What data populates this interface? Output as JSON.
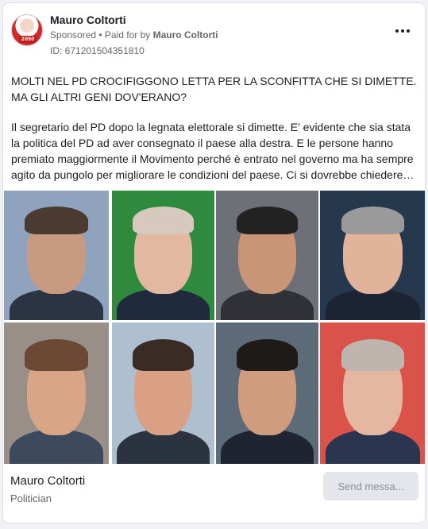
{
  "header": {
    "page_name": "Mauro Coltorti",
    "sponsored_label": "Sponsored",
    "separator": " • ",
    "paid_for_prefix": "Paid for by ",
    "paid_for_name": "Mauro Coltorti",
    "ad_id": "ID: 671201504351810",
    "avatar_badge": "2050",
    "more_icon": "more-horizontal-icon"
  },
  "post": {
    "title": "MOLTI NEL PD CROCIFIGGONO LETTA PER LA SCONFITTA CHE SI DIMETTE. MA GLI ALTRI GENI DOV'ERANO?",
    "body": "Il segretario del PD dopo la legnata elettorale si dimette. E' evidente che sia stata la politica del PD ad aver consegnato il paese alla destra. E le persone hanno premiato maggiormente il Movimento perché è entrato nel governo ma ha sempre agito da pungolo per migliorare le condizioni del paese. Ci si dovrebbe chiedere…"
  },
  "collage": {
    "photos": [
      {
        "bg": "#8fa3bf",
        "skin": "#c99a82",
        "hair": "#4a3a30",
        "suit": "#2b3445"
      },
      {
        "bg": "#2e8a3c",
        "skin": "#e2b8a0",
        "hair": "#d7c9bd",
        "suit": "#1f2a3c"
      },
      {
        "bg": "#6d7077",
        "skin": "#c89676",
        "hair": "#222222",
        "suit": "#2f3136"
      },
      {
        "bg": "#26384d",
        "skin": "#e1b39a",
        "hair": "#9a9a9a",
        "suit": "#1c2433"
      },
      {
        "bg": "#9a8f88",
        "skin": "#d9a587",
        "hair": "#6b4a35",
        "suit": "#3d4a5e"
      },
      {
        "bg": "#aebfd0",
        "skin": "#d9a084",
        "hair": "#3a2c25",
        "suit": "#2b3240"
      },
      {
        "bg": "#5d6b78",
        "skin": "#cf9c7e",
        "hair": "#1e1a18",
        "suit": "#1e2432"
      },
      {
        "bg": "#d9534a",
        "skin": "#e6b7a0",
        "hair": "#bdb5ae",
        "suit": "#2a3550"
      }
    ]
  },
  "footer": {
    "name": "Mauro Coltorti",
    "role": "Politician",
    "send_button": "Send messa..."
  }
}
